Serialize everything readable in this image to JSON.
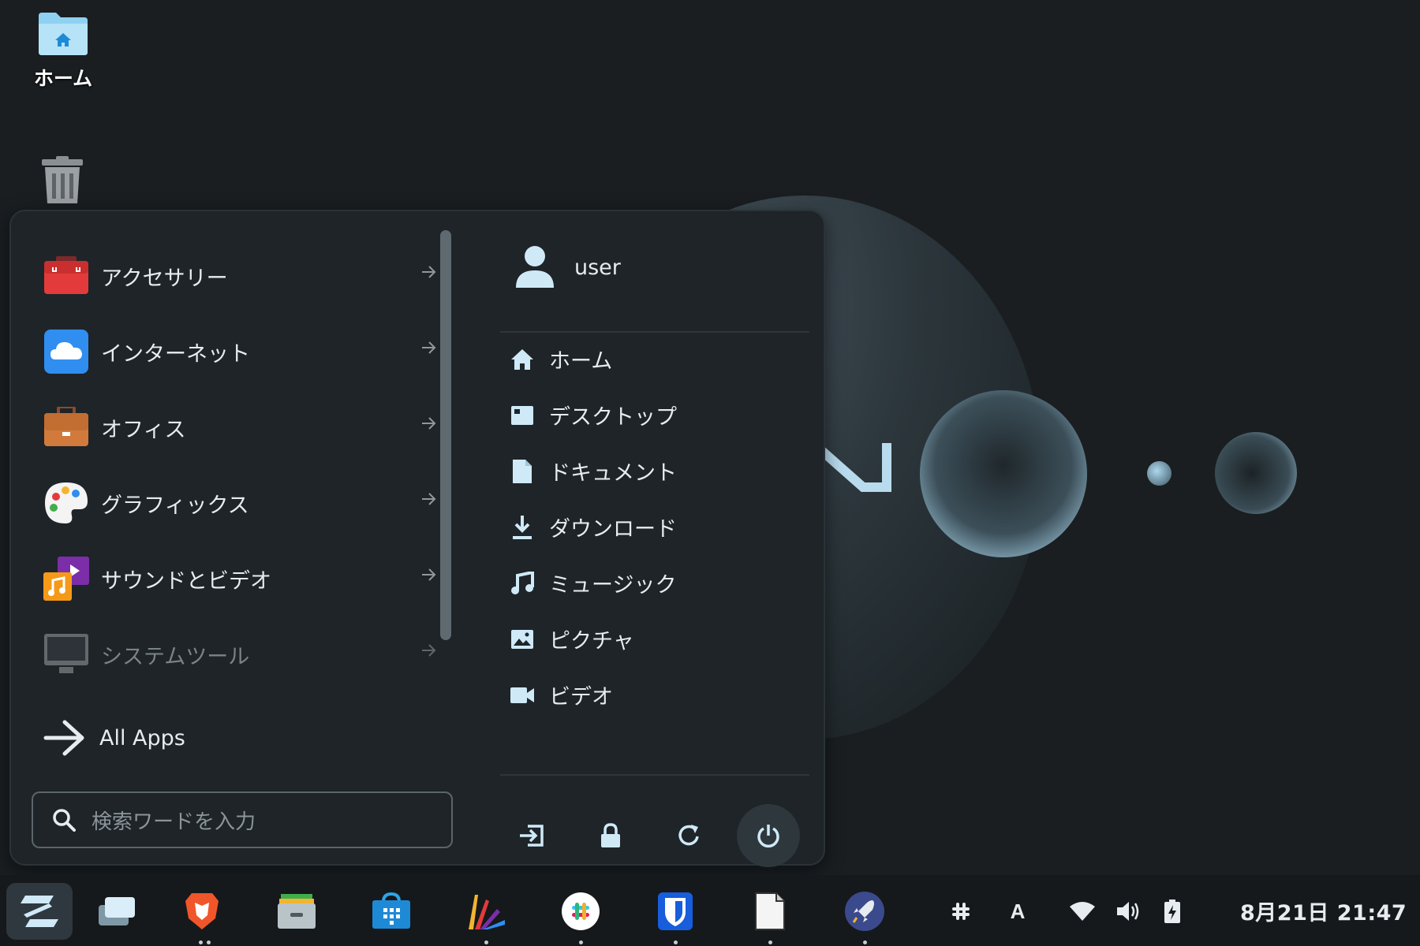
{
  "desktop": {
    "home_label": "ホーム"
  },
  "menu": {
    "categories": [
      {
        "label": "アクセサリー",
        "icon": "accessories-icon",
        "enabled": true
      },
      {
        "label": "インターネット",
        "icon": "internet-cloud-icon",
        "enabled": true
      },
      {
        "label": "オフィス",
        "icon": "office-briefcase-icon",
        "enabled": true
      },
      {
        "label": "グラフィックス",
        "icon": "graphics-palette-icon",
        "enabled": true
      },
      {
        "label": "サウンドとビデオ",
        "icon": "sound-video-icon",
        "enabled": true
      },
      {
        "label": "システムツール",
        "icon": "system-tools-monitor-icon",
        "enabled": false
      }
    ],
    "all_apps_label": "All Apps",
    "search_placeholder": "検索ワードを入力",
    "user_name": "user",
    "places": [
      {
        "label": "ホーム",
        "icon": "home-icon"
      },
      {
        "label": "デスクトップ",
        "icon": "desktop-icon"
      },
      {
        "label": "ドキュメント",
        "icon": "document-icon"
      },
      {
        "label": "ダウンロード",
        "icon": "download-icon"
      },
      {
        "label": "ミュージック",
        "icon": "music-icon"
      },
      {
        "label": "ピクチャ",
        "icon": "picture-icon"
      },
      {
        "label": "ビデオ",
        "icon": "video-icon"
      }
    ],
    "power_buttons": [
      "logout-icon",
      "lock-icon",
      "restart-icon",
      "power-icon"
    ]
  },
  "taskbar": {
    "apps": [
      "zorin-menu-icon",
      "workspaces-icon",
      "brave-browser-icon",
      "files-icon",
      "software-store-icon",
      "drawing-app-icon",
      "slack-icon",
      "bitwarden-icon",
      "text-editor-icon",
      "launcher-rocket-icon"
    ],
    "tray": [
      "slack-tray-icon",
      "input-method-icon",
      "wifi-icon",
      "volume-icon",
      "battery-icon"
    ],
    "input_method_label": "A",
    "clock": "8月21日  21:47"
  },
  "colors": {
    "menu_bg": "#1e2428",
    "accent_blue": "#3a8eea",
    "text": "#e6ecef"
  }
}
